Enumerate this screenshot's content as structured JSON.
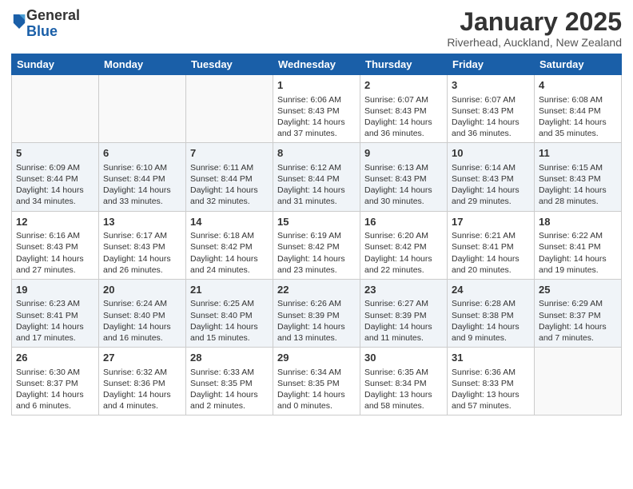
{
  "logo": {
    "general": "General",
    "blue": "Blue"
  },
  "title": "January 2025",
  "location": "Riverhead, Auckland, New Zealand",
  "days_of_week": [
    "Sunday",
    "Monday",
    "Tuesday",
    "Wednesday",
    "Thursday",
    "Friday",
    "Saturday"
  ],
  "weeks": [
    [
      {
        "day": "",
        "lines": []
      },
      {
        "day": "",
        "lines": []
      },
      {
        "day": "",
        "lines": []
      },
      {
        "day": "1",
        "lines": [
          "Sunrise: 6:06 AM",
          "Sunset: 8:43 PM",
          "Daylight: 14 hours",
          "and 37 minutes."
        ]
      },
      {
        "day": "2",
        "lines": [
          "Sunrise: 6:07 AM",
          "Sunset: 8:43 PM",
          "Daylight: 14 hours",
          "and 36 minutes."
        ]
      },
      {
        "day": "3",
        "lines": [
          "Sunrise: 6:07 AM",
          "Sunset: 8:43 PM",
          "Daylight: 14 hours",
          "and 36 minutes."
        ]
      },
      {
        "day": "4",
        "lines": [
          "Sunrise: 6:08 AM",
          "Sunset: 8:44 PM",
          "Daylight: 14 hours",
          "and 35 minutes."
        ]
      }
    ],
    [
      {
        "day": "5",
        "lines": [
          "Sunrise: 6:09 AM",
          "Sunset: 8:44 PM",
          "Daylight: 14 hours",
          "and 34 minutes."
        ]
      },
      {
        "day": "6",
        "lines": [
          "Sunrise: 6:10 AM",
          "Sunset: 8:44 PM",
          "Daylight: 14 hours",
          "and 33 minutes."
        ]
      },
      {
        "day": "7",
        "lines": [
          "Sunrise: 6:11 AM",
          "Sunset: 8:44 PM",
          "Daylight: 14 hours",
          "and 32 minutes."
        ]
      },
      {
        "day": "8",
        "lines": [
          "Sunrise: 6:12 AM",
          "Sunset: 8:44 PM",
          "Daylight: 14 hours",
          "and 31 minutes."
        ]
      },
      {
        "day": "9",
        "lines": [
          "Sunrise: 6:13 AM",
          "Sunset: 8:43 PM",
          "Daylight: 14 hours",
          "and 30 minutes."
        ]
      },
      {
        "day": "10",
        "lines": [
          "Sunrise: 6:14 AM",
          "Sunset: 8:43 PM",
          "Daylight: 14 hours",
          "and 29 minutes."
        ]
      },
      {
        "day": "11",
        "lines": [
          "Sunrise: 6:15 AM",
          "Sunset: 8:43 PM",
          "Daylight: 14 hours",
          "and 28 minutes."
        ]
      }
    ],
    [
      {
        "day": "12",
        "lines": [
          "Sunrise: 6:16 AM",
          "Sunset: 8:43 PM",
          "Daylight: 14 hours",
          "and 27 minutes."
        ]
      },
      {
        "day": "13",
        "lines": [
          "Sunrise: 6:17 AM",
          "Sunset: 8:43 PM",
          "Daylight: 14 hours",
          "and 26 minutes."
        ]
      },
      {
        "day": "14",
        "lines": [
          "Sunrise: 6:18 AM",
          "Sunset: 8:42 PM",
          "Daylight: 14 hours",
          "and 24 minutes."
        ]
      },
      {
        "day": "15",
        "lines": [
          "Sunrise: 6:19 AM",
          "Sunset: 8:42 PM",
          "Daylight: 14 hours",
          "and 23 minutes."
        ]
      },
      {
        "day": "16",
        "lines": [
          "Sunrise: 6:20 AM",
          "Sunset: 8:42 PM",
          "Daylight: 14 hours",
          "and 22 minutes."
        ]
      },
      {
        "day": "17",
        "lines": [
          "Sunrise: 6:21 AM",
          "Sunset: 8:41 PM",
          "Daylight: 14 hours",
          "and 20 minutes."
        ]
      },
      {
        "day": "18",
        "lines": [
          "Sunrise: 6:22 AM",
          "Sunset: 8:41 PM",
          "Daylight: 14 hours",
          "and 19 minutes."
        ]
      }
    ],
    [
      {
        "day": "19",
        "lines": [
          "Sunrise: 6:23 AM",
          "Sunset: 8:41 PM",
          "Daylight: 14 hours",
          "and 17 minutes."
        ]
      },
      {
        "day": "20",
        "lines": [
          "Sunrise: 6:24 AM",
          "Sunset: 8:40 PM",
          "Daylight: 14 hours",
          "and 16 minutes."
        ]
      },
      {
        "day": "21",
        "lines": [
          "Sunrise: 6:25 AM",
          "Sunset: 8:40 PM",
          "Daylight: 14 hours",
          "and 15 minutes."
        ]
      },
      {
        "day": "22",
        "lines": [
          "Sunrise: 6:26 AM",
          "Sunset: 8:39 PM",
          "Daylight: 14 hours",
          "and 13 minutes."
        ]
      },
      {
        "day": "23",
        "lines": [
          "Sunrise: 6:27 AM",
          "Sunset: 8:39 PM",
          "Daylight: 14 hours",
          "and 11 minutes."
        ]
      },
      {
        "day": "24",
        "lines": [
          "Sunrise: 6:28 AM",
          "Sunset: 8:38 PM",
          "Daylight: 14 hours",
          "and 9 minutes."
        ]
      },
      {
        "day": "25",
        "lines": [
          "Sunrise: 6:29 AM",
          "Sunset: 8:37 PM",
          "Daylight: 14 hours",
          "and 7 minutes."
        ]
      }
    ],
    [
      {
        "day": "26",
        "lines": [
          "Sunrise: 6:30 AM",
          "Sunset: 8:37 PM",
          "Daylight: 14 hours",
          "and 6 minutes."
        ]
      },
      {
        "day": "27",
        "lines": [
          "Sunrise: 6:32 AM",
          "Sunset: 8:36 PM",
          "Daylight: 14 hours",
          "and 4 minutes."
        ]
      },
      {
        "day": "28",
        "lines": [
          "Sunrise: 6:33 AM",
          "Sunset: 8:35 PM",
          "Daylight: 14 hours",
          "and 2 minutes."
        ]
      },
      {
        "day": "29",
        "lines": [
          "Sunrise: 6:34 AM",
          "Sunset: 8:35 PM",
          "Daylight: 14 hours",
          "and 0 minutes."
        ]
      },
      {
        "day": "30",
        "lines": [
          "Sunrise: 6:35 AM",
          "Sunset: 8:34 PM",
          "Daylight: 13 hours",
          "and 58 minutes."
        ]
      },
      {
        "day": "31",
        "lines": [
          "Sunrise: 6:36 AM",
          "Sunset: 8:33 PM",
          "Daylight: 13 hours",
          "and 57 minutes."
        ]
      },
      {
        "day": "",
        "lines": []
      }
    ]
  ]
}
